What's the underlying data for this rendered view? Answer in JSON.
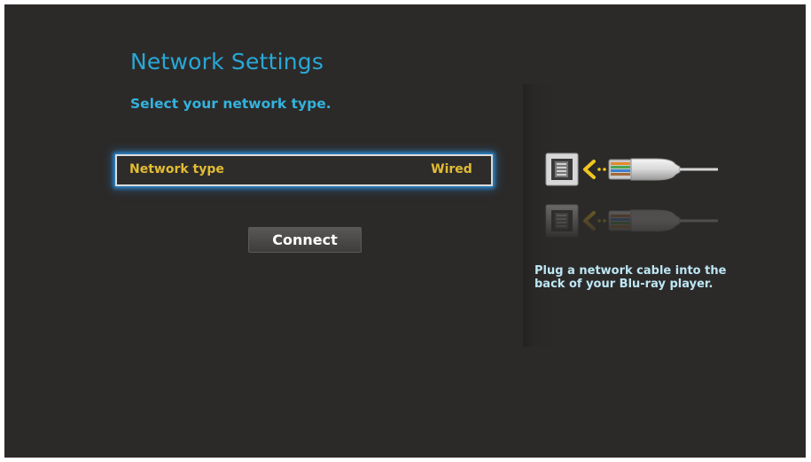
{
  "page": {
    "title": "Network Settings",
    "subtitle": "Select your network type."
  },
  "network_type_row": {
    "label": "Network type",
    "value": "Wired"
  },
  "connect_button": {
    "label": "Connect"
  },
  "side_panel": {
    "illustration": "ethernet-cable-plug-icon",
    "hint": "Plug a network cable into the back of your Blu-ray player."
  },
  "colors": {
    "background": "#2c2a29",
    "title": "#28a8d6",
    "selected_text": "#e2bc34",
    "focus_glow": "#2b8cd0",
    "hint_text": "#bde6f4"
  }
}
